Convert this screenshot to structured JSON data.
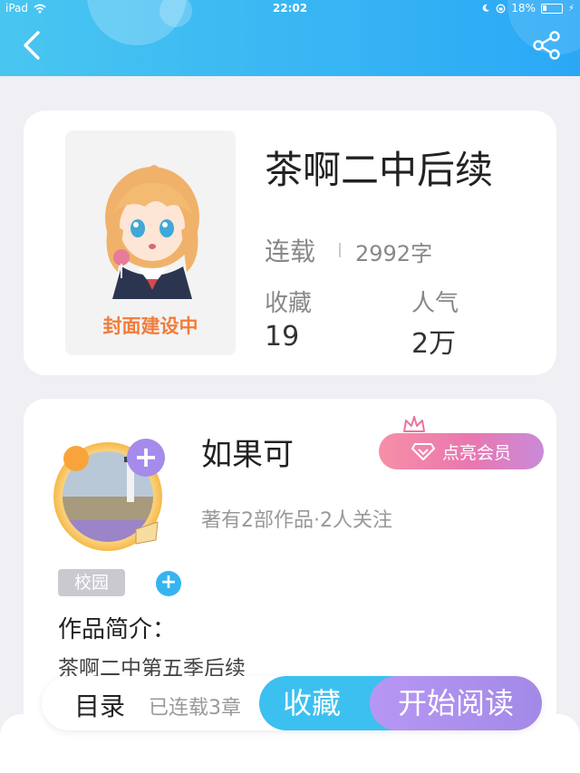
{
  "status_bar": {
    "device": "iPad",
    "time": "22:02",
    "battery": "18%"
  },
  "header": {
    "back_icon": "back-arrow-icon",
    "share_icon": "share-icon"
  },
  "book": {
    "title": "茶啊二中后续",
    "cover_caption": "封面建设中",
    "status": "连载",
    "word_count": "2992字",
    "favorites_label": "收藏",
    "favorites_value": "19",
    "popularity_label": "人气",
    "popularity_value": "2万"
  },
  "author": {
    "name": "如果可",
    "member_button": "点亮会员",
    "meta": "著有2部作品·2人关注",
    "follow_icon": "plus-icon"
  },
  "tags": [
    {
      "label": "校园"
    }
  ],
  "intro": {
    "title": "作品简介：",
    "text": "茶啊二中第五季后续"
  },
  "bottom_bar": {
    "toc_label": "目录",
    "serial_label": "已连载3章",
    "favorite_button": "收藏",
    "read_button": "开始阅读"
  },
  "colors": {
    "header_start": "#49c6f0",
    "header_end": "#2aa8f6",
    "favorite_button": "#3cc0f0",
    "read_button": "#a28ae6",
    "member_button": "#e977b0"
  }
}
